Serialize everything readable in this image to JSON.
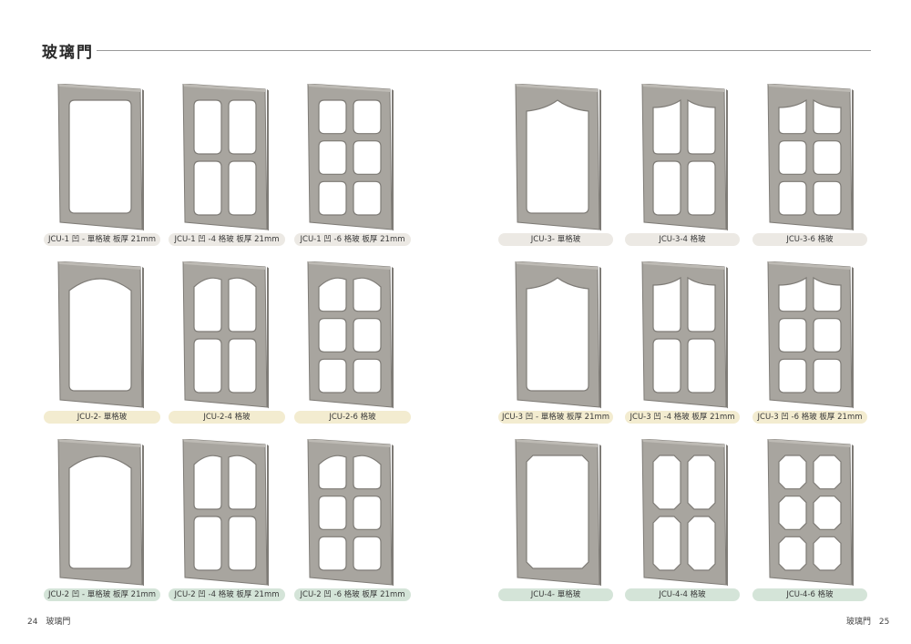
{
  "header": {
    "title": "玻璃門"
  },
  "doors": [
    {
      "label": "JCU-1 凹 - 單格玻 板厚 21mm",
      "top": "rect",
      "grid": 1,
      "corner": "round",
      "tone": "gray"
    },
    {
      "label": "JCU-1 凹 -4 格玻 板厚 21mm",
      "top": "rect",
      "grid": 4,
      "corner": "round",
      "tone": "gray"
    },
    {
      "label": "JCU-1 凹 -6 格玻 板厚 21mm",
      "top": "rect",
      "grid": 6,
      "corner": "round",
      "tone": "gray"
    },
    {
      "label": "JCU-3- 單格玻",
      "top": "cathedral",
      "grid": 1,
      "corner": "round",
      "tone": "gray"
    },
    {
      "label": "JCU-3-4 格玻",
      "top": "cathedral",
      "grid": 4,
      "corner": "round",
      "tone": "gray"
    },
    {
      "label": "JCU-3-6 格玻",
      "top": "cathedral",
      "grid": 6,
      "corner": "round",
      "tone": "gray"
    },
    {
      "label": "JCU-2- 單格玻",
      "top": "arch",
      "grid": 1,
      "corner": "round",
      "tone": "yellow"
    },
    {
      "label": "JCU-2-4 格玻",
      "top": "arch",
      "grid": 4,
      "corner": "round",
      "tone": "yellow"
    },
    {
      "label": "JCU-2-6 格玻",
      "top": "arch",
      "grid": 6,
      "corner": "round",
      "tone": "yellow"
    },
    {
      "label": "JCU-3 凹 - 單格玻 板厚 21mm",
      "top": "cathedral",
      "grid": 1,
      "corner": "round",
      "tone": "yellow"
    },
    {
      "label": "JCU-3 凹 -4 格玻 板厚 21mm",
      "top": "cathedral",
      "grid": 4,
      "corner": "round",
      "tone": "yellow"
    },
    {
      "label": "JCU-3 凹 -6 格玻 板厚 21mm",
      "top": "cathedral",
      "grid": 6,
      "corner": "round",
      "tone": "yellow"
    },
    {
      "label": "JCU-2 凹 - 單格玻 板厚 21mm",
      "top": "arch",
      "grid": 1,
      "corner": "round",
      "tone": "green"
    },
    {
      "label": "JCU-2 凹 -4 格玻 板厚 21mm",
      "top": "arch",
      "grid": 4,
      "corner": "round",
      "tone": "green"
    },
    {
      "label": "JCU-2 凹 -6 格玻 板厚 21mm",
      "top": "arch",
      "grid": 6,
      "corner": "round",
      "tone": "green"
    },
    {
      "label": "JCU-4- 單格玻",
      "top": "rect",
      "grid": 1,
      "corner": "chamfer",
      "tone": "green"
    },
    {
      "label": "JCU-4-4 格玻",
      "top": "rect",
      "grid": 4,
      "corner": "chamfer",
      "tone": "green"
    },
    {
      "label": "JCU-4-6 格玻",
      "top": "rect",
      "grid": 6,
      "corner": "chamfer",
      "tone": "green"
    }
  ],
  "footer": {
    "left_page": "24",
    "left_title": "玻璃門",
    "right_title": "玻璃門",
    "right_page": "25"
  },
  "colors": {
    "panel_face": "#a8a59f",
    "panel_edge": "#7e7b76",
    "panel_highlight": "#bdbab4",
    "gray_label": "#ece9e4",
    "yellow_label": "#f3ecd0",
    "green_label": "#d4e4d8"
  }
}
